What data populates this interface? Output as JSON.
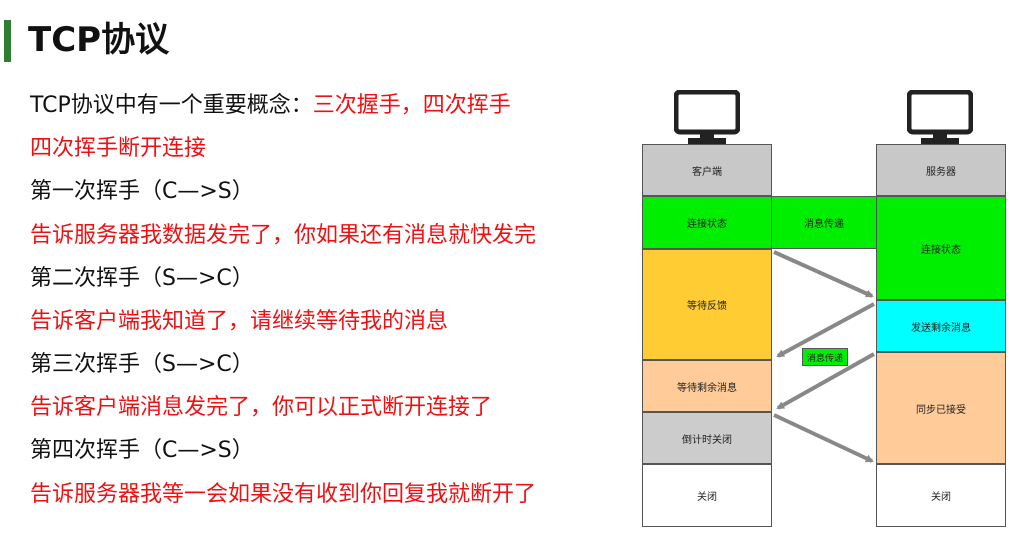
{
  "header": {
    "title": "TCP协议"
  },
  "text": {
    "l1_black": "TCP协议中有一个重要概念：",
    "l1_red": "三次握手，四次挥手",
    "l2": "四次挥手断开连接",
    "l3": "第一次挥手（C—>S）",
    "l4": "告诉服务器我数据发完了，你如果还有消息就快发完",
    "l5": "第二次挥手（S—>C）",
    "l6": "告诉客户端我知道了，请继续等待我的消息",
    "l7": "第三次挥手（S—>C）",
    "l8": "告诉客户端消息发完了，你可以正式断开连接了",
    "l9": "第四次挥手（C—>S）",
    "l10": "告诉服务器我等一会如果没有收到你回复我就断开了"
  },
  "diagram": {
    "client": {
      "header": "客户端",
      "state_connected": "连接状态",
      "state_wait_feedback": "等待反馈",
      "state_wait_remaining": "等待剩余消息",
      "state_countdown": "倒计时关闭",
      "state_closed": "关闭"
    },
    "server": {
      "header": "服务器",
      "state_connected": "连接状态",
      "state_send_remaining": "发送剩余消息",
      "state_ack": "同步已接受",
      "state_closed": "关闭"
    },
    "message_transfer_1": "消息传递",
    "message_transfer_2": "消息传递"
  },
  "colors": {
    "title_bar": "#2e7d32",
    "red_text": "#ee1111",
    "header_gray": "#c8c8c8",
    "connected_green": "#00ee00",
    "wait_yellow": "#ffcc33",
    "peach": "#ffcc99",
    "cyan": "#00ffff",
    "countdown_gray": "#cccccc",
    "arrow": "#888888"
  }
}
